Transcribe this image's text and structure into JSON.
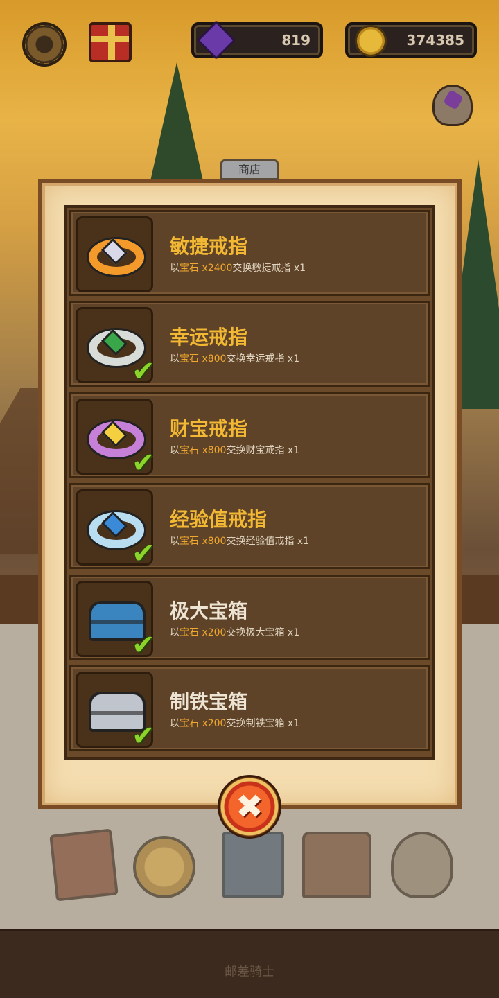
{
  "hud": {
    "gems": "819",
    "coins": "374385"
  },
  "panel": {
    "tab_label": "商店"
  },
  "items": [
    {
      "title": "敏捷戒指",
      "prefix": "以",
      "currency": "宝石",
      "amount": " x2400",
      "suffix": "交换敏捷戒指 x1",
      "purchased": false,
      "title_color": "gold",
      "icon": "orange-ring-icon"
    },
    {
      "title": "幸运戒指",
      "prefix": "以",
      "currency": "宝石",
      "amount": " x800",
      "suffix": "交换幸运戒指 x1",
      "purchased": true,
      "title_color": "gold",
      "icon": "green-ring-icon"
    },
    {
      "title": "财宝戒指",
      "prefix": "以",
      "currency": "宝石",
      "amount": " x800",
      "suffix": "交换财宝戒指 x1",
      "purchased": true,
      "title_color": "gold",
      "icon": "purple-ring-icon"
    },
    {
      "title": "经验值戒指",
      "prefix": "以",
      "currency": "宝石",
      "amount": " x800",
      "suffix": "交换经验值戒指 x1",
      "purchased": true,
      "title_color": "gold",
      "icon": "blue-ring-icon"
    },
    {
      "title": "极大宝箱",
      "prefix": "以",
      "currency": "宝石",
      "amount": " x200",
      "suffix": "交换极大宝箱 x1",
      "purchased": true,
      "title_color": "white",
      "icon": "blue-chest-icon"
    },
    {
      "title": "制铁宝箱",
      "prefix": "以",
      "currency": "宝石",
      "amount": " x200",
      "suffix": "交换制铁宝箱 x1",
      "purchased": true,
      "title_color": "white",
      "icon": "iron-chest-icon"
    }
  ],
  "close_symbol": "✖",
  "check_symbol": "✔",
  "footer": {
    "title": "邮差骑士"
  },
  "colors": {
    "highlight": "#f0a830",
    "title_gold": "#f2b834"
  }
}
